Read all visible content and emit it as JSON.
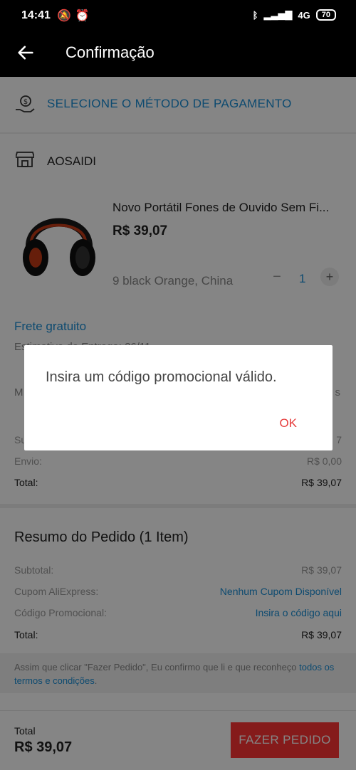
{
  "status_bar": {
    "time": "14:41",
    "network": "4G",
    "battery": "70"
  },
  "app_bar": {
    "title": "Confirmação"
  },
  "payment": {
    "label": "SELECIONE O MÉTODO DE PAGAMENTO"
  },
  "store": {
    "name": "AOSAIDI"
  },
  "product": {
    "title": "Novo Portátil Fones de Ouvido Sem Fi...",
    "price": "R$ 39,07",
    "variant": "9 black Orange, China",
    "quantity": "1",
    "shipping": "Frete gratuito",
    "estimate_partial": "Estimativa de Entrega: 26/11",
    "message_partial": "M",
    "message_right": "s",
    "subtotal_partial_label": "Su",
    "subtotal_partial_value": "7",
    "shipping_label": "Envio:",
    "shipping_value": "R$ 0,00",
    "total_label": "Total:",
    "total_value": "R$ 39,07"
  },
  "summary": {
    "heading": "Resumo do Pedido (1 Item)",
    "subtotal_label": "Subtotal:",
    "subtotal_value": "R$ 39,07",
    "coupon_label": "Cupom AliExpress:",
    "coupon_value": "Nenhum Cupom Disponível",
    "promo_label": "Código Promocional:",
    "promo_value": "Insira o código aqui",
    "total_label": "Total:",
    "total_value": "R$ 39,07"
  },
  "terms": {
    "text": "Assim que clicar \"Fazer Pedido\", Eu confirmo que li e que reconheço ",
    "link": "todos os termos e condições",
    "end": "."
  },
  "bottom": {
    "total_label": "Total",
    "total_value": "R$ 39,07",
    "order_button": "FAZER PEDIDO"
  },
  "dialog": {
    "message": "Insira um código promocional válido.",
    "ok": "OK"
  }
}
